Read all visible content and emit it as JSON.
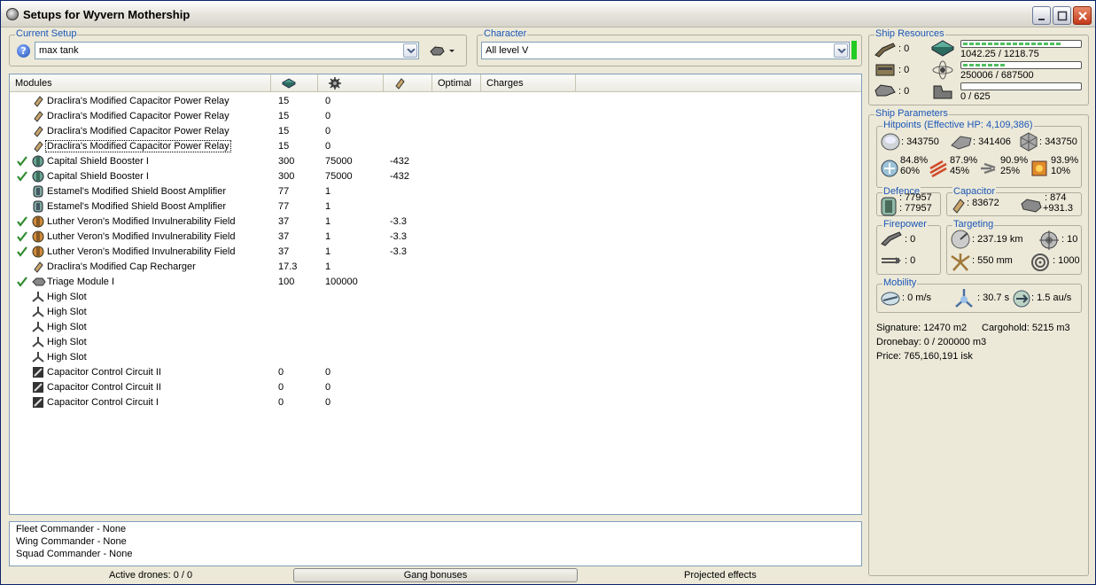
{
  "window": {
    "title": "Setups for Wyvern Mothership"
  },
  "current_setup": {
    "label": "Current Setup",
    "value": "max tank"
  },
  "character": {
    "label": "Character",
    "value": "All level V"
  },
  "module_list": {
    "columns": {
      "modules": "Modules",
      "optimal": "Optimal",
      "charges": "Charges"
    },
    "rows": [
      {
        "name": "Draclira's Modified Capacitor Power Relay",
        "c1": "15",
        "c2": "0",
        "c3": "",
        "active": false,
        "icon": "capacitor-relay-icon"
      },
      {
        "name": "Draclira's Modified Capacitor Power Relay",
        "c1": "15",
        "c2": "0",
        "c3": "",
        "active": false,
        "icon": "capacitor-relay-icon"
      },
      {
        "name": "Draclira's Modified Capacitor Power Relay",
        "c1": "15",
        "c2": "0",
        "c3": "",
        "active": false,
        "icon": "capacitor-relay-icon"
      },
      {
        "name": "Draclira's Modified Capacitor Power Relay",
        "c1": "15",
        "c2": "0",
        "c3": "",
        "active": false,
        "icon": "capacitor-relay-icon"
      },
      {
        "name": "Capital Shield Booster I",
        "c1": "300",
        "c2": "75000",
        "c3": "-432",
        "active": true,
        "icon": "shield-booster-icon"
      },
      {
        "name": "Capital Shield Booster I",
        "c1": "300",
        "c2": "75000",
        "c3": "-432",
        "active": true,
        "icon": "shield-booster-icon"
      },
      {
        "name": "Estamel's Modified Shield Boost Amplifier",
        "c1": "77",
        "c2": "1",
        "c3": "",
        "active": false,
        "icon": "shield-amplifier-icon"
      },
      {
        "name": "Estamel's Modified Shield Boost Amplifier",
        "c1": "77",
        "c2": "1",
        "c3": "",
        "active": false,
        "icon": "shield-amplifier-icon"
      },
      {
        "name": "Luther Veron's Modified Invulnerability Field",
        "c1": "37",
        "c2": "1",
        "c3": "-3.3",
        "active": true,
        "icon": "invulnerability-field-icon"
      },
      {
        "name": "Luther Veron's Modified Invulnerability Field",
        "c1": "37",
        "c2": "1",
        "c3": "-3.3",
        "active": true,
        "icon": "invulnerability-field-icon"
      },
      {
        "name": "Luther Veron's Modified Invulnerability Field",
        "c1": "37",
        "c2": "1",
        "c3": "-3.3",
        "active": true,
        "icon": "invulnerability-field-icon"
      },
      {
        "name": "Draclira's Modified Cap Recharger",
        "c1": "17.3",
        "c2": "1",
        "c3": "",
        "active": false,
        "icon": "cap-recharger-icon"
      },
      {
        "name": "Triage Module I",
        "c1": "100",
        "c2": "100000",
        "c3": "",
        "active": true,
        "icon": "triage-module-icon"
      },
      {
        "name": "High Slot",
        "c1": "",
        "c2": "",
        "c3": "",
        "active": false,
        "icon": "high-slot-icon"
      },
      {
        "name": "High Slot",
        "c1": "",
        "c2": "",
        "c3": "",
        "active": false,
        "icon": "high-slot-icon"
      },
      {
        "name": "High Slot",
        "c1": "",
        "c2": "",
        "c3": "",
        "active": false,
        "icon": "high-slot-icon"
      },
      {
        "name": "High Slot",
        "c1": "",
        "c2": "",
        "c3": "",
        "active": false,
        "icon": "high-slot-icon"
      },
      {
        "name": "High Slot",
        "c1": "",
        "c2": "",
        "c3": "",
        "active": false,
        "icon": "high-slot-icon"
      },
      {
        "name": "Capacitor Control Circuit II",
        "c1": "0",
        "c2": "0",
        "c3": "",
        "active": false,
        "icon": "rig-icon"
      },
      {
        "name": "Capacitor Control Circuit II",
        "c1": "0",
        "c2": "0",
        "c3": "",
        "active": false,
        "icon": "rig-icon"
      },
      {
        "name": "Capacitor Control Circuit I",
        "c1": "0",
        "c2": "0",
        "c3": "",
        "active": false,
        "icon": "rig-icon"
      }
    ]
  },
  "fleet": {
    "fleet_commander": "Fleet Commander - None",
    "wing_commander": "Wing Commander - None",
    "squad_commander": "Squad Commander - None"
  },
  "status": {
    "active_drones": "Active drones: 0 / 0",
    "gang_bonuses": "Gang bonuses",
    "projected_effects": "Projected effects"
  },
  "ship_resources": {
    "label": "Ship Resources",
    "turret_slots": ": 0",
    "launcher_slots": ": 0",
    "drone_slots": ": 0",
    "cpu": "1042.25 / 1218.75",
    "cpu_fraction": 0.855,
    "powergrid": "250006 / 687500",
    "powergrid_fraction": 0.364,
    "calibration": "0 / 625",
    "calibration_fraction": 0
  },
  "ship_parameters": {
    "label": "Ship Parameters",
    "hitpoints_label": "Hitpoints (Effective HP: 4,109,386)",
    "shield_hp": ": 343750",
    "armor_hp": ": 341406",
    "structure_hp": ": 343750",
    "resists": [
      {
        "top": "84.8%",
        "bottom": "60%"
      },
      {
        "top": "87.9%",
        "bottom": "45%"
      },
      {
        "top": "90.9%",
        "bottom": "25%"
      },
      {
        "top": "93.9%",
        "bottom": "10%"
      }
    ],
    "defence_label": "Defence",
    "defence_1": ": 77957",
    "defence_2": ": 77957",
    "capacitor_label": "Capacitor",
    "capacitor_amount": ": 83672",
    "capacitor_delta_1": ": 874",
    "capacitor_delta_2": "+931.3",
    "firepower_label": "Firepower",
    "firepower_1": ": 0",
    "firepower_2": ": 0",
    "targeting_label": "Targeting",
    "targeting_range": ": 237.19 km",
    "targeting_targets": ": 10",
    "scan_resolution": ": 550 mm",
    "sensor_strength": ": 1000",
    "mobility_label": "Mobility",
    "velocity": ": 0 m/s",
    "align_time": ": 30.7 s",
    "warp_speed": ": 1.5 au/s",
    "signature": "Signature: 12470 m2",
    "cargohold": "Cargohold: 5215 m3",
    "dronebay": "Dronebay: 0 / 200000 m3",
    "price": "Price: 765,160,191 isk"
  },
  "colors": {
    "accent_label": "#1b56b7",
    "status_ok": "#22cc22",
    "check": "#2e8b2e"
  }
}
